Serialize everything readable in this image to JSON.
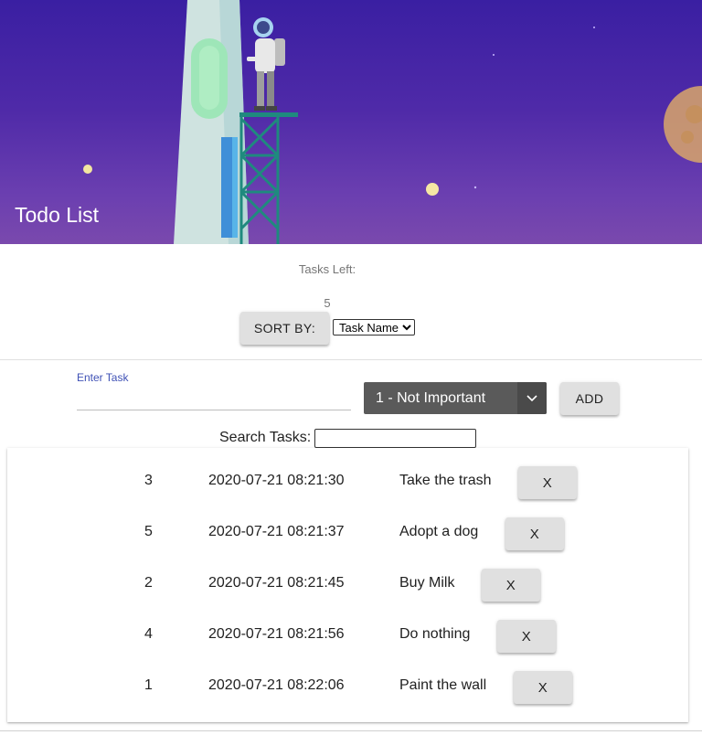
{
  "app": {
    "title": "Todo List"
  },
  "summary": {
    "tasks_left_label": "Tasks Left:",
    "tasks_left_count": "5"
  },
  "sort": {
    "button_label": "SORT BY:",
    "selected": "Task Name",
    "options": [
      "Task Name"
    ]
  },
  "new_task": {
    "label": "Enter Task",
    "value": "",
    "importance_selected": "1 - Not Important",
    "add_label": "ADD"
  },
  "search": {
    "label": "Search Tasks:",
    "value": ""
  },
  "tasks": [
    {
      "importance": "3",
      "date": "2020-07-21 08:21:30",
      "name": "Take the trash",
      "delete_label": "X"
    },
    {
      "importance": "5",
      "date": "2020-07-21 08:21:37",
      "name": "Adopt a dog",
      "delete_label": "X"
    },
    {
      "importance": "2",
      "date": "2020-07-21 08:21:45",
      "name": "Buy Milk",
      "delete_label": "X"
    },
    {
      "importance": "4",
      "date": "2020-07-21 08:21:56",
      "name": "Do nothing",
      "delete_label": "X"
    },
    {
      "importance": "1",
      "date": "2020-07-21 08:22:06",
      "name": "Paint the wall",
      "delete_label": "X"
    }
  ],
  "icons": {
    "importance_dropdown": "chevron-down-icon"
  },
  "colors": {
    "banner": "#4f2aa8",
    "accent": "#3f51b5",
    "select_bg": "#5a5a5a",
    "button_bg": "#e0e0e0"
  }
}
